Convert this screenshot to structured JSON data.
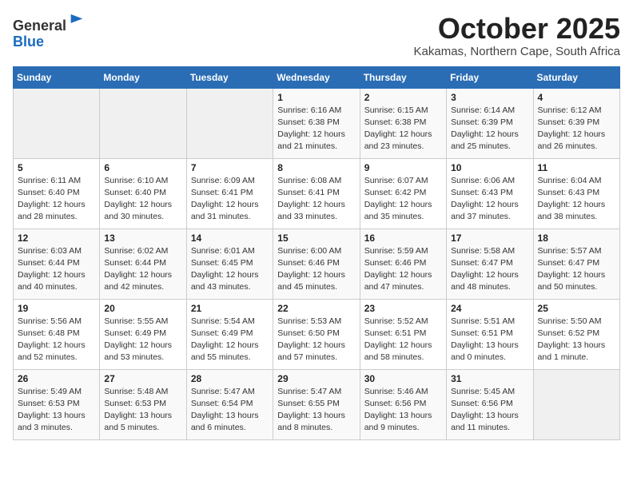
{
  "header": {
    "logo_line1": "General",
    "logo_line2": "Blue",
    "month": "October 2025",
    "location": "Kakamas, Northern Cape, South Africa"
  },
  "weekdays": [
    "Sunday",
    "Monday",
    "Tuesday",
    "Wednesday",
    "Thursday",
    "Friday",
    "Saturday"
  ],
  "weeks": [
    [
      {
        "day": "",
        "info": ""
      },
      {
        "day": "",
        "info": ""
      },
      {
        "day": "",
        "info": ""
      },
      {
        "day": "1",
        "info": "Sunrise: 6:16 AM\nSunset: 6:38 PM\nDaylight: 12 hours\nand 21 minutes."
      },
      {
        "day": "2",
        "info": "Sunrise: 6:15 AM\nSunset: 6:38 PM\nDaylight: 12 hours\nand 23 minutes."
      },
      {
        "day": "3",
        "info": "Sunrise: 6:14 AM\nSunset: 6:39 PM\nDaylight: 12 hours\nand 25 minutes."
      },
      {
        "day": "4",
        "info": "Sunrise: 6:12 AM\nSunset: 6:39 PM\nDaylight: 12 hours\nand 26 minutes."
      }
    ],
    [
      {
        "day": "5",
        "info": "Sunrise: 6:11 AM\nSunset: 6:40 PM\nDaylight: 12 hours\nand 28 minutes."
      },
      {
        "day": "6",
        "info": "Sunrise: 6:10 AM\nSunset: 6:40 PM\nDaylight: 12 hours\nand 30 minutes."
      },
      {
        "day": "7",
        "info": "Sunrise: 6:09 AM\nSunset: 6:41 PM\nDaylight: 12 hours\nand 31 minutes."
      },
      {
        "day": "8",
        "info": "Sunrise: 6:08 AM\nSunset: 6:41 PM\nDaylight: 12 hours\nand 33 minutes."
      },
      {
        "day": "9",
        "info": "Sunrise: 6:07 AM\nSunset: 6:42 PM\nDaylight: 12 hours\nand 35 minutes."
      },
      {
        "day": "10",
        "info": "Sunrise: 6:06 AM\nSunset: 6:43 PM\nDaylight: 12 hours\nand 37 minutes."
      },
      {
        "day": "11",
        "info": "Sunrise: 6:04 AM\nSunset: 6:43 PM\nDaylight: 12 hours\nand 38 minutes."
      }
    ],
    [
      {
        "day": "12",
        "info": "Sunrise: 6:03 AM\nSunset: 6:44 PM\nDaylight: 12 hours\nand 40 minutes."
      },
      {
        "day": "13",
        "info": "Sunrise: 6:02 AM\nSunset: 6:44 PM\nDaylight: 12 hours\nand 42 minutes."
      },
      {
        "day": "14",
        "info": "Sunrise: 6:01 AM\nSunset: 6:45 PM\nDaylight: 12 hours\nand 43 minutes."
      },
      {
        "day": "15",
        "info": "Sunrise: 6:00 AM\nSunset: 6:46 PM\nDaylight: 12 hours\nand 45 minutes."
      },
      {
        "day": "16",
        "info": "Sunrise: 5:59 AM\nSunset: 6:46 PM\nDaylight: 12 hours\nand 47 minutes."
      },
      {
        "day": "17",
        "info": "Sunrise: 5:58 AM\nSunset: 6:47 PM\nDaylight: 12 hours\nand 48 minutes."
      },
      {
        "day": "18",
        "info": "Sunrise: 5:57 AM\nSunset: 6:47 PM\nDaylight: 12 hours\nand 50 minutes."
      }
    ],
    [
      {
        "day": "19",
        "info": "Sunrise: 5:56 AM\nSunset: 6:48 PM\nDaylight: 12 hours\nand 52 minutes."
      },
      {
        "day": "20",
        "info": "Sunrise: 5:55 AM\nSunset: 6:49 PM\nDaylight: 12 hours\nand 53 minutes."
      },
      {
        "day": "21",
        "info": "Sunrise: 5:54 AM\nSunset: 6:49 PM\nDaylight: 12 hours\nand 55 minutes."
      },
      {
        "day": "22",
        "info": "Sunrise: 5:53 AM\nSunset: 6:50 PM\nDaylight: 12 hours\nand 57 minutes."
      },
      {
        "day": "23",
        "info": "Sunrise: 5:52 AM\nSunset: 6:51 PM\nDaylight: 12 hours\nand 58 minutes."
      },
      {
        "day": "24",
        "info": "Sunrise: 5:51 AM\nSunset: 6:51 PM\nDaylight: 13 hours\nand 0 minutes."
      },
      {
        "day": "25",
        "info": "Sunrise: 5:50 AM\nSunset: 6:52 PM\nDaylight: 13 hours\nand 1 minute."
      }
    ],
    [
      {
        "day": "26",
        "info": "Sunrise: 5:49 AM\nSunset: 6:53 PM\nDaylight: 13 hours\nand 3 minutes."
      },
      {
        "day": "27",
        "info": "Sunrise: 5:48 AM\nSunset: 6:53 PM\nDaylight: 13 hours\nand 5 minutes."
      },
      {
        "day": "28",
        "info": "Sunrise: 5:47 AM\nSunset: 6:54 PM\nDaylight: 13 hours\nand 6 minutes."
      },
      {
        "day": "29",
        "info": "Sunrise: 5:47 AM\nSunset: 6:55 PM\nDaylight: 13 hours\nand 8 minutes."
      },
      {
        "day": "30",
        "info": "Sunrise: 5:46 AM\nSunset: 6:56 PM\nDaylight: 13 hours\nand 9 minutes."
      },
      {
        "day": "31",
        "info": "Sunrise: 5:45 AM\nSunset: 6:56 PM\nDaylight: 13 hours\nand 11 minutes."
      },
      {
        "day": "",
        "info": ""
      }
    ]
  ]
}
